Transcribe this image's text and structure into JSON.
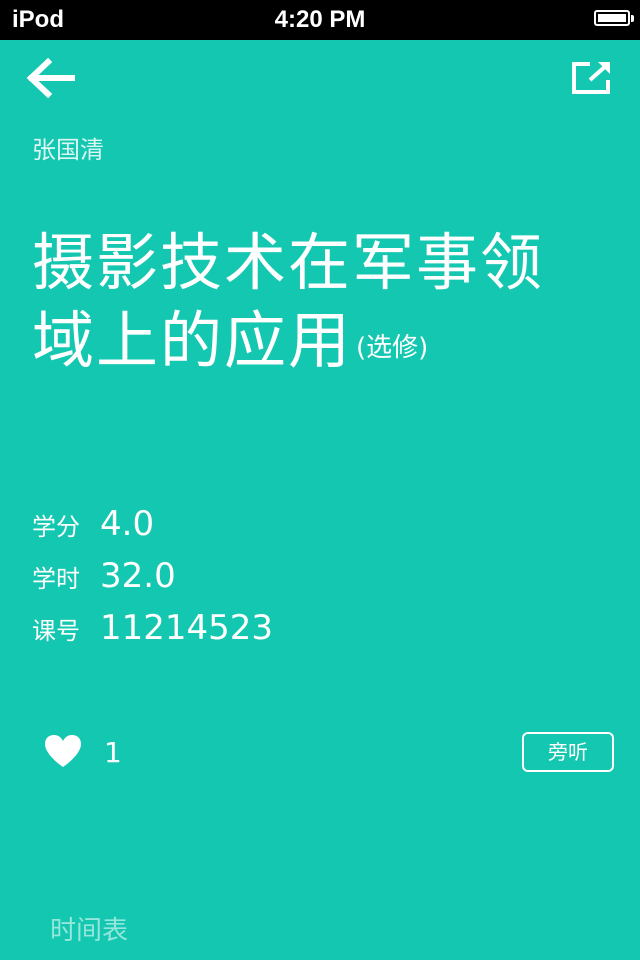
{
  "status_bar": {
    "device": "iPod",
    "time": "4:20 PM",
    "battery_icon": "battery-full-icon"
  },
  "nav": {
    "back_icon": "arrow-left-icon",
    "share_icon": "share-icon"
  },
  "teacher": "张国清",
  "course": {
    "title_line1": "摄影技术在军事领",
    "title_line2": "域上的应用",
    "type": "(选修)"
  },
  "info": {
    "credit_label": "学分",
    "credit_value": "4.0",
    "hours_label": "学时",
    "hours_value": "32.0",
    "code_label": "课号",
    "code_value": "11214523"
  },
  "actions": {
    "like_icon": "heart-icon",
    "like_count": "1",
    "audit_label": "旁听"
  },
  "footer": {
    "timetable_label": "时间表"
  },
  "colors": {
    "background": "#14c7b0",
    "text": "#ffffff",
    "status_bar": "#000000"
  }
}
